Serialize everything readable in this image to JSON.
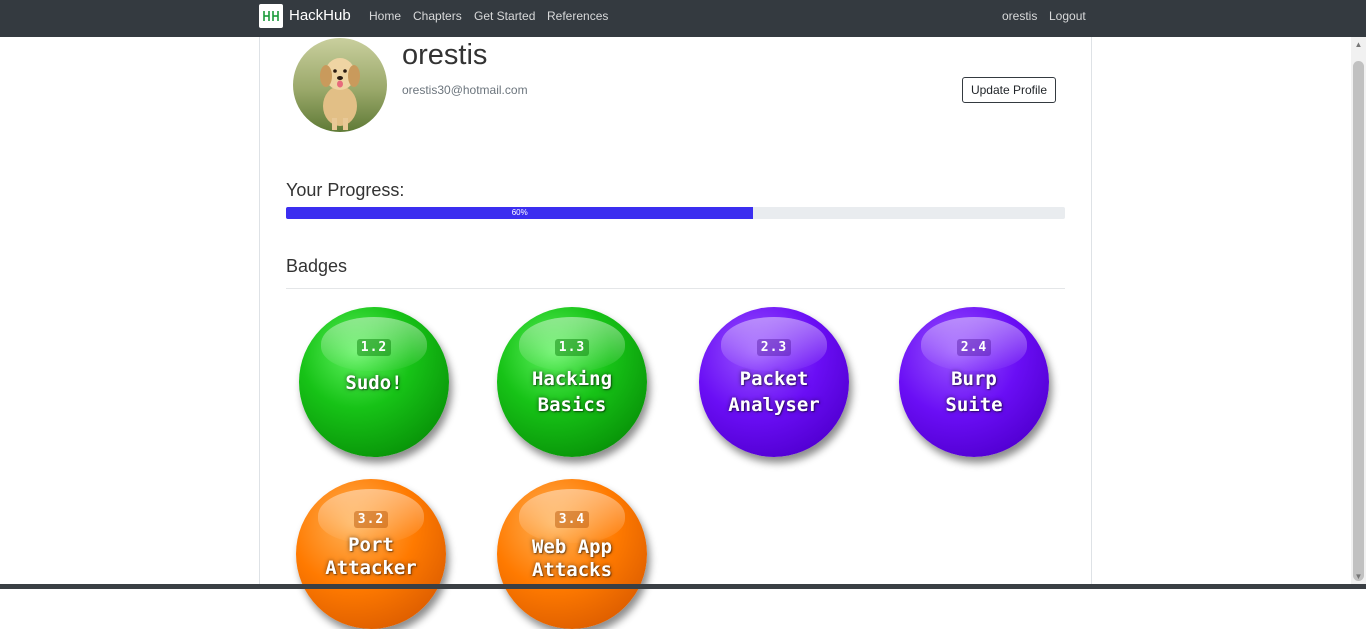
{
  "navbar": {
    "brand": "HackHub",
    "links": [
      "Home",
      "Chapters",
      "Get Started",
      "References"
    ],
    "user": "orestis",
    "logout": "Logout"
  },
  "profile": {
    "username": "orestis",
    "email": "orestis30@hotmail.com",
    "update_button": "Update Profile"
  },
  "progress": {
    "heading": "Your Progress:",
    "value": 0.6,
    "label": "60%"
  },
  "badges": {
    "heading": "Badges",
    "items": [
      {
        "number": "1.2",
        "title": "Sudo!",
        "color": "#14b814"
      },
      {
        "number": "1.3",
        "title": "Hacking\nBasics",
        "color": "#14b814"
      },
      {
        "number": "2.3",
        "title": "Packet\nAnalyser",
        "color": "#5b00e6"
      },
      {
        "number": "2.4",
        "title": "Burp\nSuite",
        "color": "#5b00e6"
      },
      {
        "number": "3.2",
        "title": "Port\nAttacker",
        "color": "#ff7a00"
      },
      {
        "number": "3.4",
        "title": "Web App\nAttacks",
        "color": "#ff7a00"
      }
    ]
  }
}
